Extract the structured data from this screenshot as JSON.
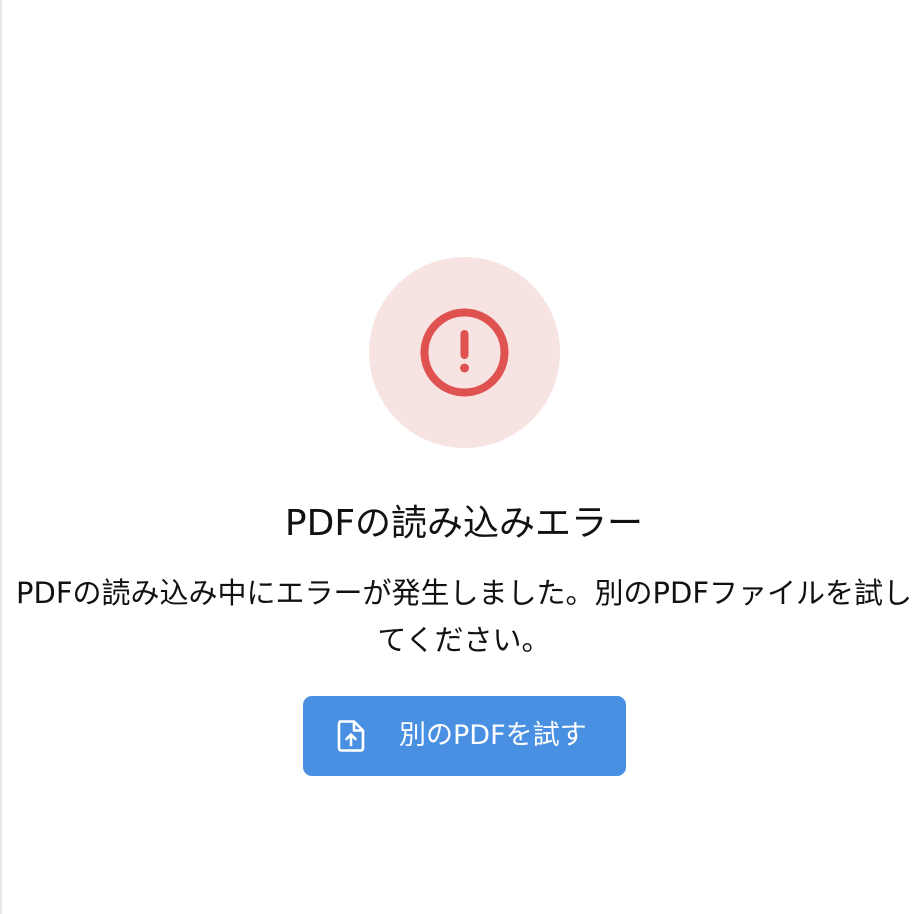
{
  "error": {
    "icon": "alert-circle-icon",
    "icon_color": "#e0524f",
    "icon_bg_color": "#f8e3e3",
    "title": "PDFの読み込みエラー",
    "message": "PDFの読み込み中にエラーが発生しました。別のPDFファイルを試してください。"
  },
  "action": {
    "label": "別のPDFを試す",
    "icon": "file-upload-icon",
    "color": "#4a90e2"
  }
}
